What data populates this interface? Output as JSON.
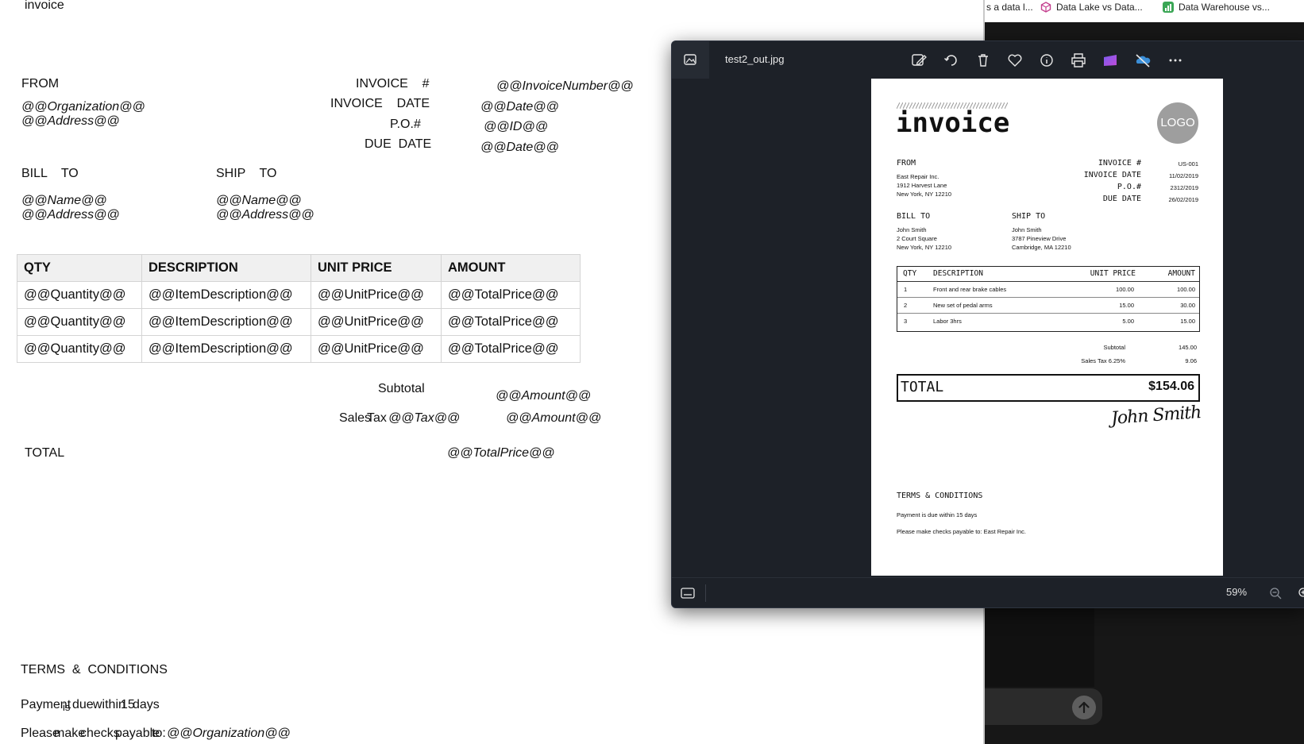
{
  "document": {
    "title": "invoice",
    "from_label": "FROM",
    "from_org": "@@Organization@@",
    "from_address": "@@Address@@",
    "invoice_no_label": "INVOICE    #",
    "invoice_date_label": "INVOICE    DATE",
    "po_label": "P.O.#",
    "due_date_label": "DUE  DATE",
    "invoice_no_value": "@@InvoiceNumber@@",
    "invoice_date_value": "@@Date@@",
    "po_value": "@@ID@@",
    "due_date_value": "@@Date@@",
    "bill_to_label": "BILL    TO",
    "ship_to_label": "SHIP    TO",
    "bill_name": "@@Name@@",
    "bill_address": "@@Address@@",
    "ship_name": "@@Name@@",
    "ship_address": "@@Address@@",
    "table": {
      "headers": [
        "QTY",
        "DESCRIPTION",
        "UNIT PRICE",
        "AMOUNT"
      ],
      "rows": [
        [
          "@@Quantity@@",
          "@@ItemDescription@@",
          "@@UnitPrice@@",
          "@@TotalPrice@@"
        ],
        [
          "@@Quantity@@",
          "@@ItemDescription@@",
          "@@UnitPrice@@",
          "@@TotalPrice@@"
        ],
        [
          "@@Quantity@@",
          "@@ItemDescription@@",
          "@@UnitPrice@@",
          "@@TotalPrice@@"
        ]
      ]
    },
    "subtotal_label": "Subtotal",
    "subtotal_value": "@@Amount@@",
    "sales_label": "Sales",
    "tax_label": "Tax",
    "tax_value": "@@Tax@@",
    "sales_tax_amount": "@@Amount@@",
    "total_label": "TOTAL",
    "total_value": "@@TotalPrice@@",
    "terms_label": "TERMS  &  CONDITIONS",
    "payment_words": [
      "Payment",
      "is",
      "due",
      "within",
      "15",
      "days"
    ],
    "please_words": [
      "Please",
      "make",
      "checks",
      "payable",
      "to:"
    ],
    "please_org": "@@Organization@@"
  },
  "browser_tabs": [
    {
      "label": "s a data l...",
      "icon_color": ""
    },
    {
      "label": "Data Lake vs Data...",
      "icon_color": "#c43f8e"
    },
    {
      "label": "Data Warehouse vs...",
      "icon_color": "#3aa655"
    }
  ],
  "chat": {
    "send_icon": "arrow-up-icon"
  },
  "viewer": {
    "filename": "test2_out.jpg",
    "zoom": "59%",
    "toolbar_icons": [
      "edit-image-icon",
      "rotate-icon",
      "delete-icon",
      "favorite-icon",
      "info-icon",
      "print-icon",
      "clipchamp-icon",
      "onedrive-icon",
      "more-icon"
    ]
  },
  "image": {
    "title": "invoice",
    "logo": "LOGO",
    "from_label": "FROM",
    "from_lines": [
      "East Repair Inc.",
      "1912 Harvest Lane",
      "New York, NY 12210"
    ],
    "meta_labels": [
      "INVOICE #",
      "INVOICE DATE",
      "P.O.#",
      "DUE DATE"
    ],
    "meta_values": [
      "US-001",
      "11/02/2019",
      "2312/2019",
      "26/02/2019"
    ],
    "bill_to_label": "BILL TO",
    "bill_lines": [
      "John Smith",
      "2 Court Square",
      "New York, NY 12210"
    ],
    "ship_to_label": "SHIP TO",
    "ship_lines": [
      "John Smith",
      "3787 Pineview Drive",
      "Cambridge, MA 12210"
    ],
    "table_headers": [
      "QTY",
      "DESCRIPTION",
      "UNIT PRICE",
      "AMOUNT"
    ],
    "rows": [
      [
        "1",
        "Front and rear brake cables",
        "100.00",
        "100.00"
      ],
      [
        "2",
        "New set of pedal arms",
        "15.00",
        "30.00"
      ],
      [
        "3",
        "Labor 3hrs",
        "5.00",
        "15.00"
      ]
    ],
    "subtotal_label": "Subtotal",
    "subtotal_value": "145.00",
    "tax_label": "Sales Tax 6.25%",
    "tax_value": "9.06",
    "total_label": "TOTAL",
    "total_value": "$154.06",
    "signature": "John Smith",
    "terms_label": "TERMS & CONDITIONS",
    "terms_lines": [
      "Payment is due within 15 days",
      "Please make checks payable to: East Repair Inc."
    ]
  }
}
